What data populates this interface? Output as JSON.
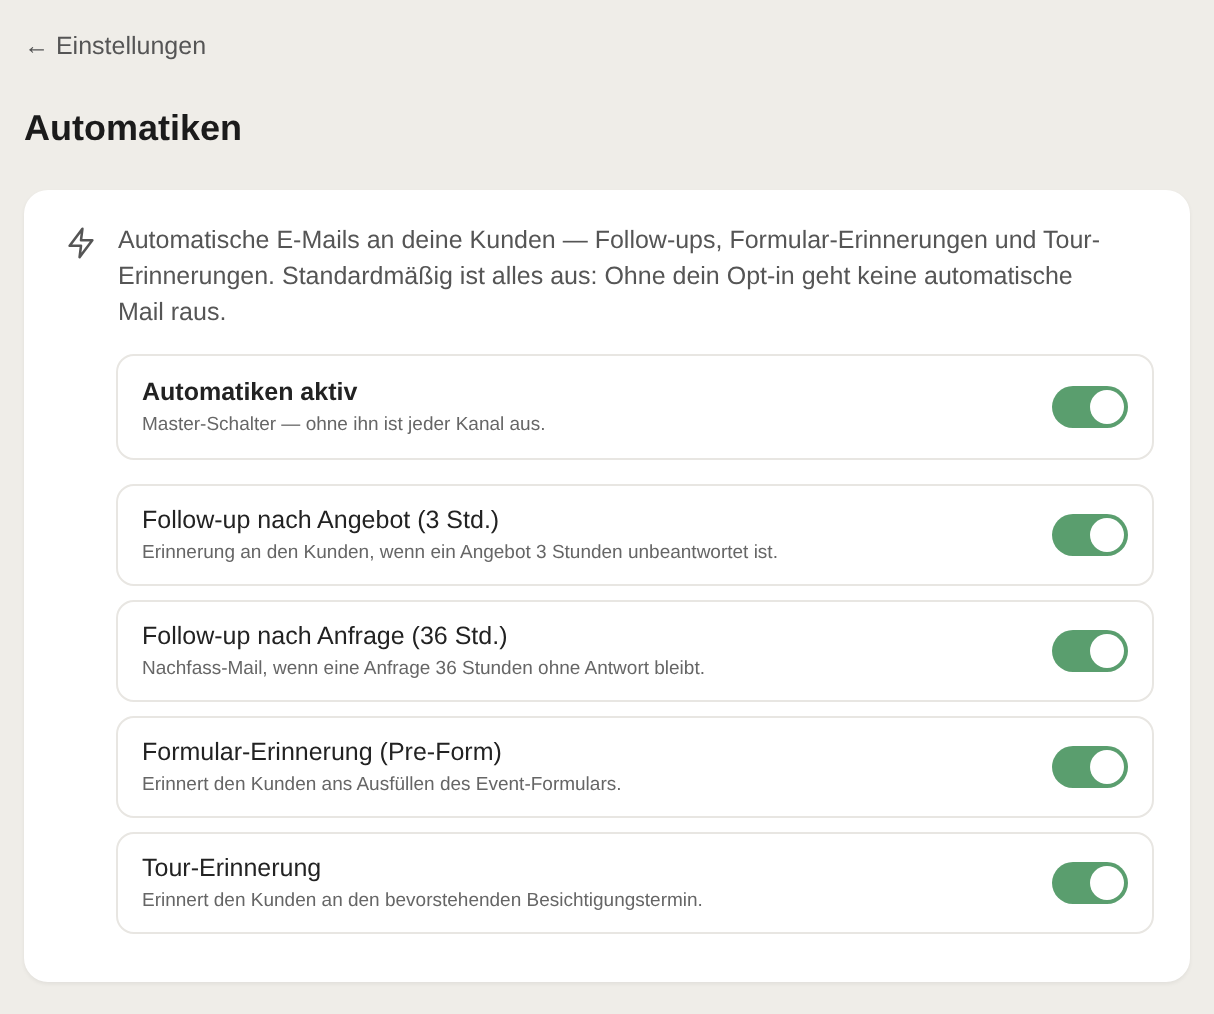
{
  "back_link": "← Einstellungen",
  "title": "Automatiken",
  "intro": "Automatische E-Mails an deine Kunden — Follow-ups, Formular-Erinnerungen und Tour-Erinnerungen. Standardmäßig ist alles aus: Ohne dein Opt-in geht keine automatische Mail raus.",
  "settings": [
    {
      "kind": "master",
      "label": "Automatiken aktiv",
      "description": "Master-Schalter — ohne ihn ist jeder Kanal aus.",
      "on": true
    },
    {
      "kind": "channel",
      "label": "Follow-up nach Angebot (3 Std.)",
      "description": "Erinnerung an den Kunden, wenn ein Angebot 3 Stunden unbeantwortet ist.",
      "on": true
    },
    {
      "kind": "channel",
      "label": "Follow-up nach Anfrage (36 Std.)",
      "description": "Nachfass-Mail, wenn eine Anfrage 36 Stunden ohne Antwort bleibt.",
      "on": true
    },
    {
      "kind": "channel",
      "label": "Formular-Erinnerung (Pre-Form)",
      "description": "Erinnert den Kunden ans Ausfüllen des Event-Formulars.",
      "on": true
    },
    {
      "kind": "channel",
      "label": "Tour-Erinnerung",
      "description": "Erinnert den Kunden an den bevorstehenden Besichtigungstermin.",
      "on": true
    }
  ]
}
